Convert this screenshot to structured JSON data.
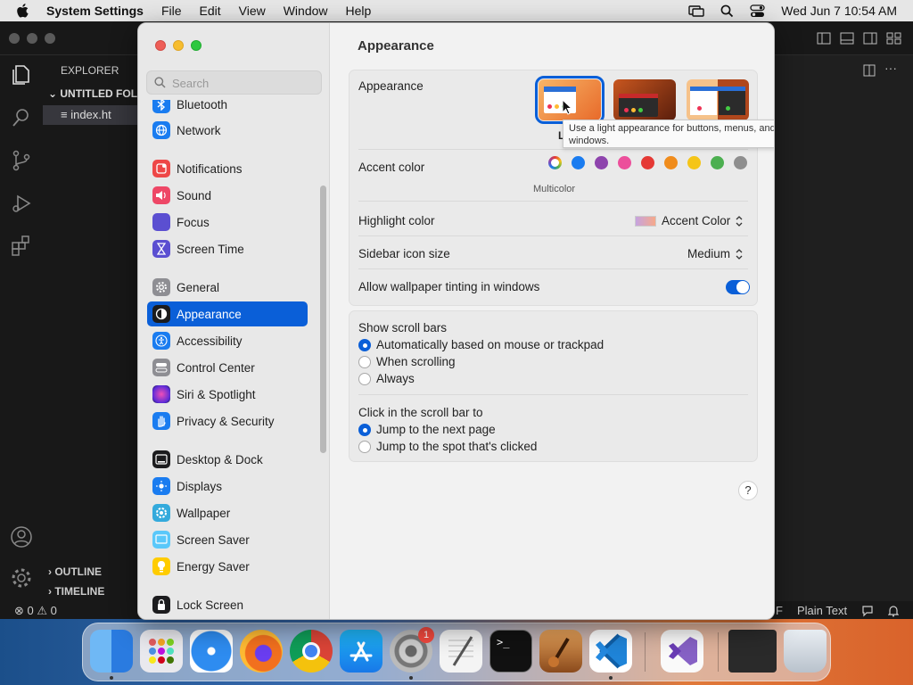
{
  "menubar": {
    "app_name": "System Settings",
    "menus": [
      "File",
      "Edit",
      "View",
      "Window",
      "Help"
    ],
    "clock": "Wed Jun 7  10:54 AM"
  },
  "vscode": {
    "explorer_label": "EXPLORER",
    "folder_label": "UNTITLED FOLD",
    "file_label": "index.ht",
    "outline_label": "OUTLINE",
    "timeline_label": "TIMELINE",
    "status_problems": "0",
    "status_warnings": "0",
    "status_lf": "F",
    "status_language": "Plain Text"
  },
  "settings": {
    "search_placeholder": "Search",
    "sidebar_items": [
      {
        "label": "Bluetooth",
        "icon": "bluetooth-icon",
        "color": "#1a7cf0"
      },
      {
        "label": "Network",
        "icon": "network-icon",
        "color": "#1a7cf0"
      },
      {
        "label": "Notifications",
        "icon": "notifications-icon",
        "color": "#ee4747"
      },
      {
        "label": "Sound",
        "icon": "sound-icon",
        "color": "#ee4766"
      },
      {
        "label": "Focus",
        "icon": "focus-icon",
        "color": "#5b4fd1"
      },
      {
        "label": "Screen Time",
        "icon": "screen-time-icon",
        "color": "#5b4fd1"
      },
      {
        "label": "General",
        "icon": "gear-icon",
        "color": "#8e8e93"
      },
      {
        "label": "Appearance",
        "icon": "appearance-icon",
        "color": "#1c1c1e"
      },
      {
        "label": "Accessibility",
        "icon": "accessibility-icon",
        "color": "#1a7cf0"
      },
      {
        "label": "Control Center",
        "icon": "control-center-icon",
        "color": "#8e8e93"
      },
      {
        "label": "Siri & Spotlight",
        "icon": "siri-icon",
        "color": "#c93cbf"
      },
      {
        "label": "Privacy & Security",
        "icon": "hand-icon",
        "color": "#1a7cf0"
      },
      {
        "label": "Desktop & Dock",
        "icon": "dock-icon",
        "color": "#1c1c1e"
      },
      {
        "label": "Displays",
        "icon": "displays-icon",
        "color": "#1a7cf0"
      },
      {
        "label": "Wallpaper",
        "icon": "wallpaper-icon",
        "color": "#34aadc"
      },
      {
        "label": "Screen Saver",
        "icon": "screen-saver-icon",
        "color": "#5ac8fa"
      },
      {
        "label": "Energy Saver",
        "icon": "energy-icon",
        "color": "#ffcc00"
      },
      {
        "label": "Lock Screen",
        "icon": "lock-icon",
        "color": "#1c1c1e"
      }
    ],
    "title": "Appearance",
    "appearance_label": "Appearance",
    "appearance_selected_caption": "L",
    "tooltip": "Use a light appearance for buttons, menus, and windows.",
    "accent_label": "Accent color",
    "accent_colors": [
      "#ffffff",
      "#1a7cf0",
      "#8e44ad",
      "#ec4f9b",
      "#e53935",
      "#f08c1c",
      "#f5c518",
      "#4caf50",
      "#8e8e8e"
    ],
    "accent_caption": "Multicolor",
    "highlight_label": "Highlight color",
    "highlight_value": "Accent Color",
    "sidebar_icon_label": "Sidebar icon size",
    "sidebar_icon_value": "Medium",
    "wallpaper_tint_label": "Allow wallpaper tinting in windows",
    "wallpaper_tint_on": true,
    "scroll_bars_label": "Show scroll bars",
    "scroll_bars_options": [
      "Automatically based on mouse or trackpad",
      "When scrolling",
      "Always"
    ],
    "click_scroll_label": "Click in the scroll bar to",
    "click_scroll_options": [
      "Jump to the next page",
      "Jump to the spot that's clicked"
    ],
    "help_label": "?"
  },
  "dock": {
    "badge_count": "1"
  }
}
